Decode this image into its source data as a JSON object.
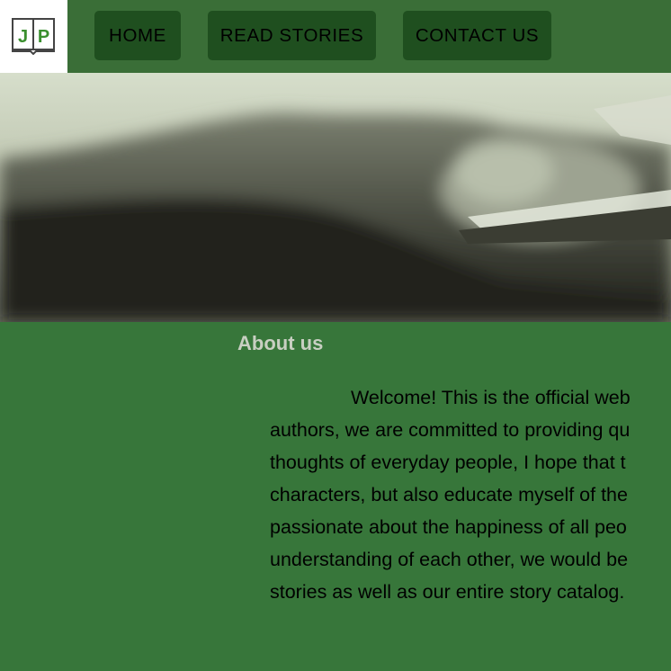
{
  "header": {
    "logo_text": "JP",
    "nav": [
      {
        "label": "HOME"
      },
      {
        "label": "READ STORIES"
      },
      {
        "label": "CONTACT US"
      }
    ]
  },
  "about": {
    "title": "About us",
    "lines": [
      "Welcome! This is the official web",
      "authors, we are committed to providing qu",
      "thoughts of everyday people, I hope that t",
      "characters, but also educate myself of the",
      "passionate about the happiness of all peo",
      "understanding of each other, we would be",
      "stories as well as our entire story catalog."
    ]
  },
  "colors": {
    "header_bg": "#3a6e37",
    "nav_button_bg": "#1f4f1f",
    "page_bg": "#37763a",
    "title_color": "#c8cfc2",
    "logo_green": "#3a8f2e"
  }
}
